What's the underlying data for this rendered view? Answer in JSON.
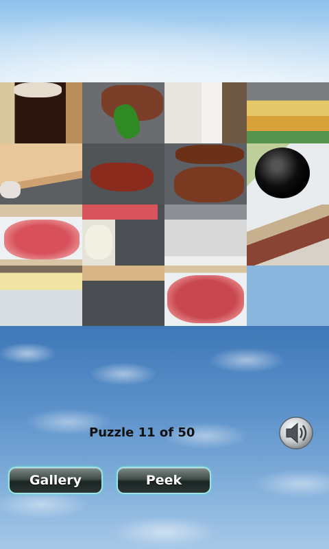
{
  "status": {
    "text": "Puzzle 11 of 50"
  },
  "buttons": {
    "gallery_label": "Gallery",
    "peek_label": "Peek"
  },
  "sound": {
    "icon": "speaker-icon"
  },
  "board": {
    "columns": 4,
    "rows": 4,
    "empty_position": "bottom-right"
  },
  "colors": {
    "button_glow": "#5ad0d4",
    "sky": "#8cc0ec",
    "clouds": "#3f78b8"
  }
}
